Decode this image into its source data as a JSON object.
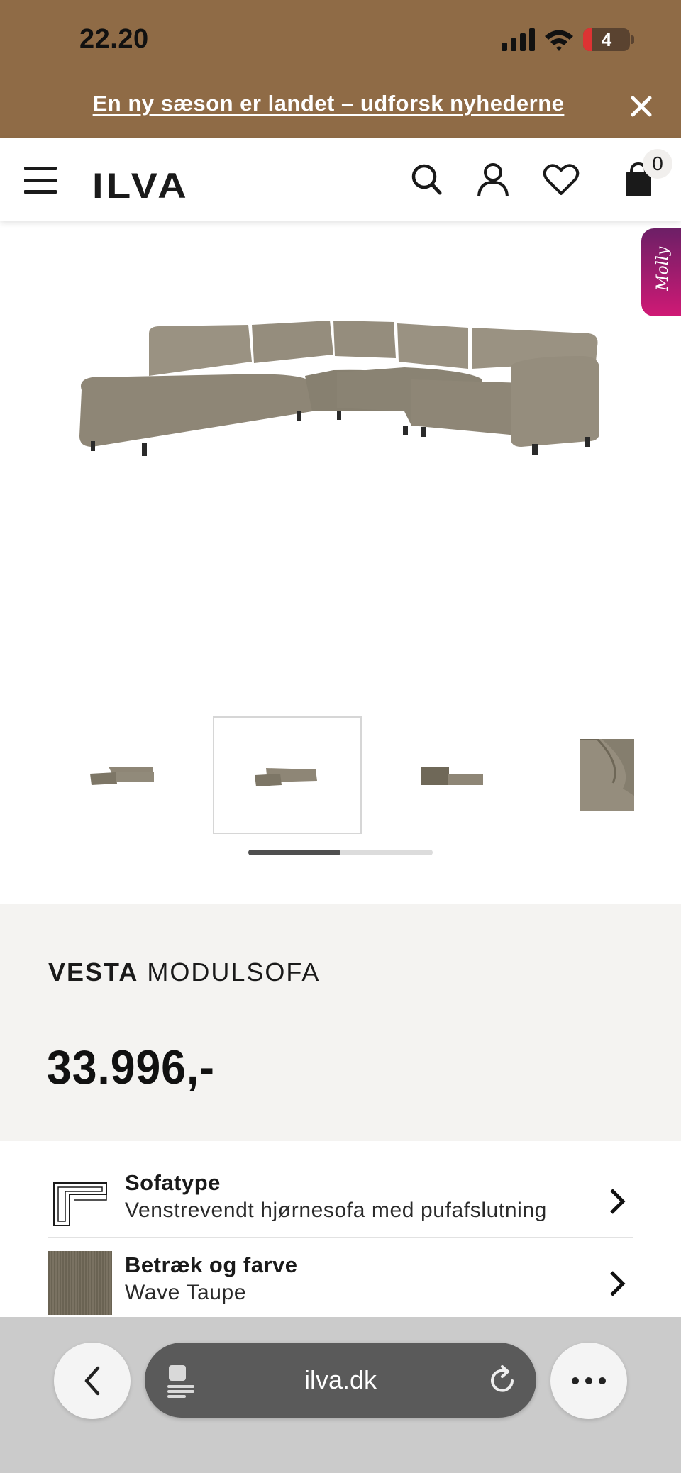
{
  "status_bar": {
    "time": "22.20",
    "battery": "4"
  },
  "promo": {
    "text": "En ny sæson er landet – udforsk nyhederne"
  },
  "header": {
    "logo": "ILVA",
    "cart_count": "0"
  },
  "chat_widget": {
    "label": "Molly"
  },
  "gallery": {
    "thumbnail_count": 4,
    "active_index": 1,
    "scroll_progress": 0.5
  },
  "product": {
    "name_bold": "VESTA",
    "name_rest": " MODULSOFA",
    "price": "33.996,-"
  },
  "options": [
    {
      "label": "Sofatype",
      "value": "Venstrevendt hjørnesofa med pufafslutning",
      "icon": "sofa-outline-icon"
    },
    {
      "label": "Betræk og farve",
      "value": "Wave Taupe",
      "icon": "fabric-swatch"
    }
  ],
  "browser": {
    "url": "ilva.dk"
  },
  "colors": {
    "banner": "#8f6b46",
    "info_bg": "#f4f3f1",
    "sofa": "#8e8676",
    "molly_start": "#6c1f66",
    "molly_end": "#d01975"
  }
}
